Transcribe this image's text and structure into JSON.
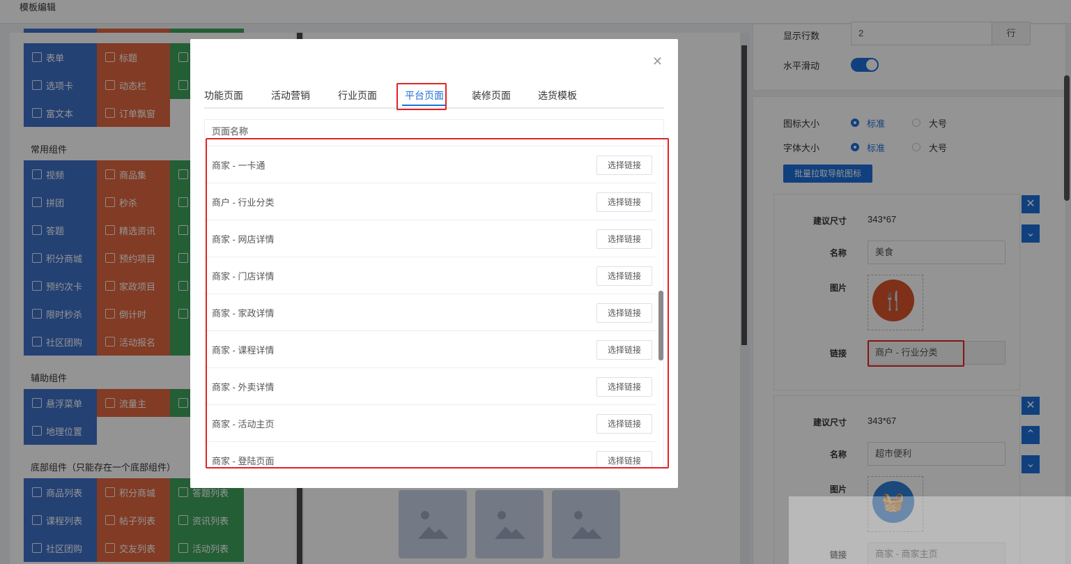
{
  "topbar": {
    "title": "模板编辑"
  },
  "left": {
    "top_row": [
      "表单",
      "标题",
      "选项卡",
      "动态栏",
      "富文本",
      "订单飘窗"
    ],
    "section_common": "常用组件",
    "common": [
      "视频",
      "商品集",
      "拼团",
      "秒杀",
      "答题",
      "精选资讯",
      "积分商城",
      "预约项目",
      "预约次卡",
      "家政项目",
      "限时秒杀",
      "倒计时",
      "社区团购",
      "活动报名"
    ],
    "section_aux": "辅助组件",
    "aux": [
      "悬浮菜单",
      "流量主",
      "地理位置"
    ],
    "section_bottom": "底部组件（只能存在一个底部组件）",
    "bottom": [
      "商品列表",
      "积分商城",
      "答题列表",
      "课程列表",
      "帖子列表",
      "资讯列表",
      "社区团购",
      "交友列表",
      "活动列表"
    ]
  },
  "right": {
    "rows_label": "显示行数",
    "rows_value": "2",
    "rows_unit": "行",
    "hscroll_label": "水平滑动",
    "icon_size_label": "图标大小",
    "font_size_label": "字体大小",
    "opt_standard": "标准",
    "opt_large": "大号",
    "batch_button": "批量拉取导航图标",
    "items": [
      {
        "size_label": "建议尺寸",
        "size": "343*67",
        "name_label": "名称",
        "name": "美食",
        "image_label": "图片",
        "link_label": "链接",
        "link": "商户 - 行业分类"
      },
      {
        "size_label": "建议尺寸",
        "size": "343*67",
        "name_label": "名称",
        "name": "超市便利",
        "image_label": "图片",
        "link_label": "链接",
        "link": "商家 - 商家主页"
      }
    ]
  },
  "modal": {
    "tabs": [
      "功能页面",
      "活动营销",
      "行业页面",
      "平台页面",
      "装修页面",
      "选货模板"
    ],
    "active_tab": "平台页面",
    "column_header": "页面名称",
    "select_label": "选择链接",
    "rows": [
      "商家 - 一卡通",
      "商户 - 行业分类",
      "商家 - 网店详情",
      "商家 - 门店详情",
      "商家 - 家政详情",
      "商家 - 课程详情",
      "商家 - 外卖详情",
      "商家 - 活动主页",
      "商家 - 登陆页面"
    ]
  },
  "colors": {
    "accent": "#1e6fd9",
    "highlight": "#e02424",
    "tile_blue": "#3e70c8",
    "tile_orange": "#e0673e",
    "tile_green": "#3ea35c"
  }
}
